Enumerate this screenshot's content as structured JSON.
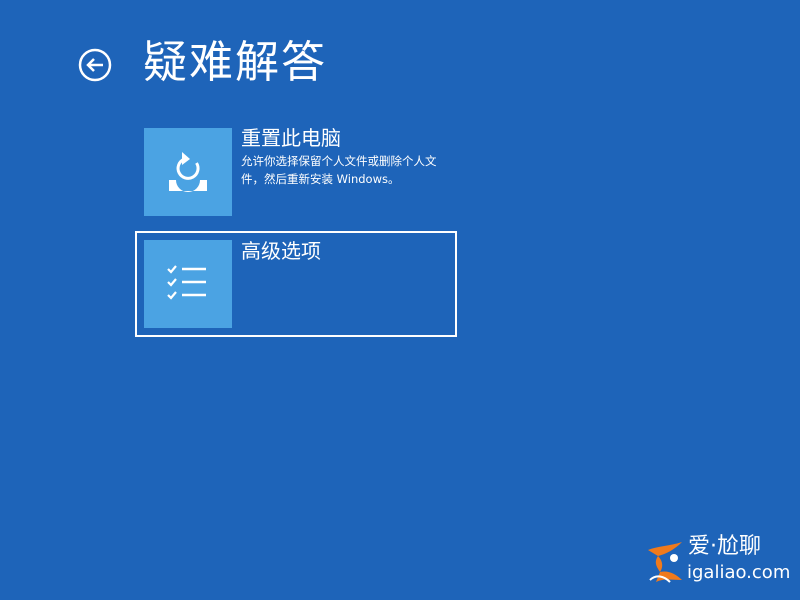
{
  "page": {
    "title": "疑难解答",
    "background_color": "#1e64b9",
    "tile_color": "#4ba3e3"
  },
  "back_button": {
    "icon": "back-arrow-icon"
  },
  "options": [
    {
      "title": "重置此电脑",
      "description": "允许你选择保留个人文件或删除个人文件，然后重新安装 Windows。",
      "icon": "reset-pc-icon",
      "focused": false
    },
    {
      "title": "高级选项",
      "description": "",
      "icon": "checklist-icon",
      "focused": true
    }
  ],
  "watermark": {
    "brand": "爱·尬聊",
    "url": "igaliao.com",
    "logo_colors": [
      "#f07a1c",
      "#ffffff"
    ]
  }
}
